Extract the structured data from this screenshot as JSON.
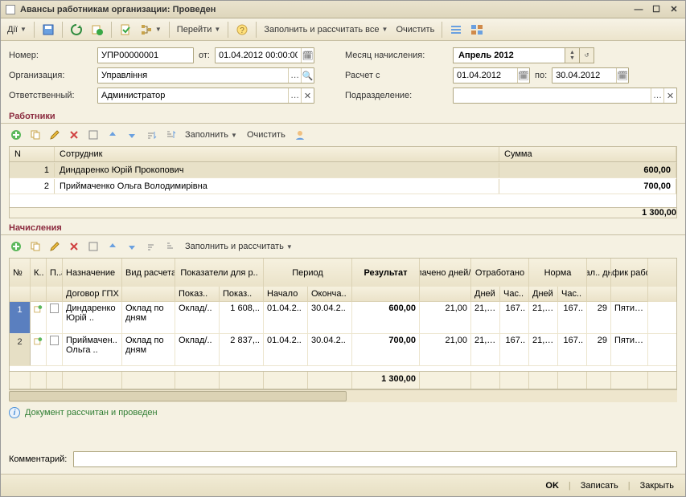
{
  "window": {
    "title": "Авансы работникам организации: Проведен"
  },
  "toolbar": {
    "actions": "Дії",
    "goto": "Перейти",
    "fill_calc": "Заполнить и рассчитать все",
    "clear": "Очистить"
  },
  "form": {
    "number_label": "Номер:",
    "number_value": "УПР00000001",
    "from_label": "от:",
    "from_value": "01.04.2012 00:00:00",
    "org_label": "Организация:",
    "org_value": "Управління",
    "resp_label": "Ответственный:",
    "resp_value": "Администратор",
    "month_label": "Месяц начисления:",
    "month_value": "Апрель 2012",
    "calc_from_label": "Расчет с",
    "calc_from_value": "01.04.2012",
    "to_label": "по:",
    "to_value": "30.04.2012",
    "dept_label": "Подразделение:",
    "dept_value": ""
  },
  "workers": {
    "title": "Работники",
    "fill": "Заполнить",
    "clear": "Очистить",
    "cols": {
      "n": "N",
      "emp": "Сотрудник",
      "sum": "Сумма"
    },
    "rows": [
      {
        "n": "1",
        "emp": "Диндаренко Юрій Прокопович",
        "sum": "600,00"
      },
      {
        "n": "2",
        "emp": "Приймаченко Ольга Володимирівна",
        "sum": "700,00"
      }
    ],
    "total": "1 300,00"
  },
  "accruals": {
    "title": "Начисления",
    "fill": "Заполнить и рассчитать",
    "cols": {
      "n": "№",
      "k": "К..",
      "p": "П..а..",
      "naz": "Назначение",
      "dog": "Договор ГПХ",
      "vid": "Вид расчета",
      "pok_top": "Показатели для р..",
      "pok1": "Показ..",
      "pok2": "Показ..",
      "per_top": "Период",
      "per1": "Начало",
      "per2": "Оконча..",
      "res": "Результат",
      "opl": "Оплачено дней/ча..",
      "otr_top": "Отработано",
      "otr1": "Дней",
      "otr2": "Час..",
      "nor_top": "Норма",
      "nor1": "Дней",
      "nor2": "Час..",
      "kal": "Кал.. дни",
      "gr": "График работы"
    },
    "rows": [
      {
        "n": "1",
        "naz": "Диндаренко Юрій ..",
        "vid": "Оклад по дням",
        "pok1": "Оклад/..",
        "pok2": "1 608,..",
        "per1": "01.04.2..",
        "per2": "30.04.2..",
        "res": "600,00",
        "opl": "21,00",
        "otr1": "21,00",
        "otr2": "167..",
        "nor1": "21,00",
        "nor2": "167..",
        "kal": "29",
        "gr": "Пятидн"
      },
      {
        "n": "2",
        "naz": "Приймачен.. Ольга ..",
        "vid": "Оклад по дням",
        "pok1": "Оклад/..",
        "pok2": "2 837,..",
        "per1": "01.04.2..",
        "per2": "30.04.2..",
        "res": "700,00",
        "opl": "21,00",
        "otr1": "21,00",
        "otr2": "167..",
        "nor1": "21,00",
        "nor2": "167..",
        "kal": "29",
        "gr": "Пятидн"
      }
    ],
    "total_res": "1 300,00"
  },
  "status_text": "Документ рассчитан и проведен",
  "comment_label": "Комментарий:",
  "comment_value": "",
  "bottom": {
    "ok": "OK",
    "write": "Записать",
    "close": "Закрыть"
  }
}
